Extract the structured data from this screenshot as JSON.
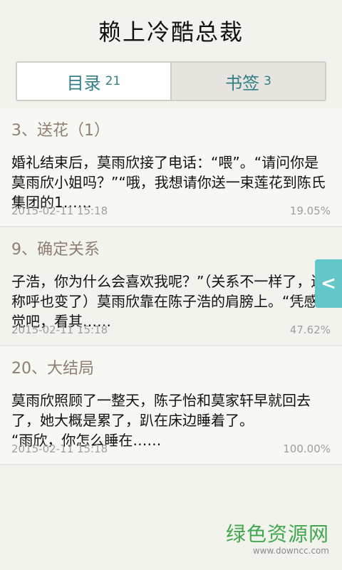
{
  "header": {
    "title": "赖上冷酷总裁"
  },
  "tabs": [
    {
      "label": "目录",
      "count": "21"
    },
    {
      "label": "书签",
      "count": "3"
    }
  ],
  "bookmarks": [
    {
      "title": "3、送花（1）",
      "text": "婚礼结束后，莫雨欣接了电话：“喂”。“请问你是莫雨欣小姐吗？”“哦，我想请你送一束莲花到陈氏集团的1……",
      "date": "2015-02-11  15:18",
      "percent": "19.05%"
    },
    {
      "title": "9、确定关系",
      "text": "子浩，你为什么会喜欢我呢？”（关系不一样了，连称呼也变了）莫雨欣靠在陈子浩的肩膀上。“凭感觉吧，看其……",
      "date": "2015-02-11  15:18",
      "percent": "47.62%"
    },
    {
      "title": "20、大结局",
      "text": "莫雨欣照顾了一整天，陈子怡和莫家轩早就回去了，她大概是累了，趴在床边睡着了。\n  “雨欣，你怎么睡在……",
      "date": "2015-02-11  15:18",
      "percent": "100.00%"
    }
  ],
  "side_handle": {
    "glyph": "<"
  },
  "watermark": {
    "main": "绿色资源网",
    "sub": "www.downcc.com"
  }
}
